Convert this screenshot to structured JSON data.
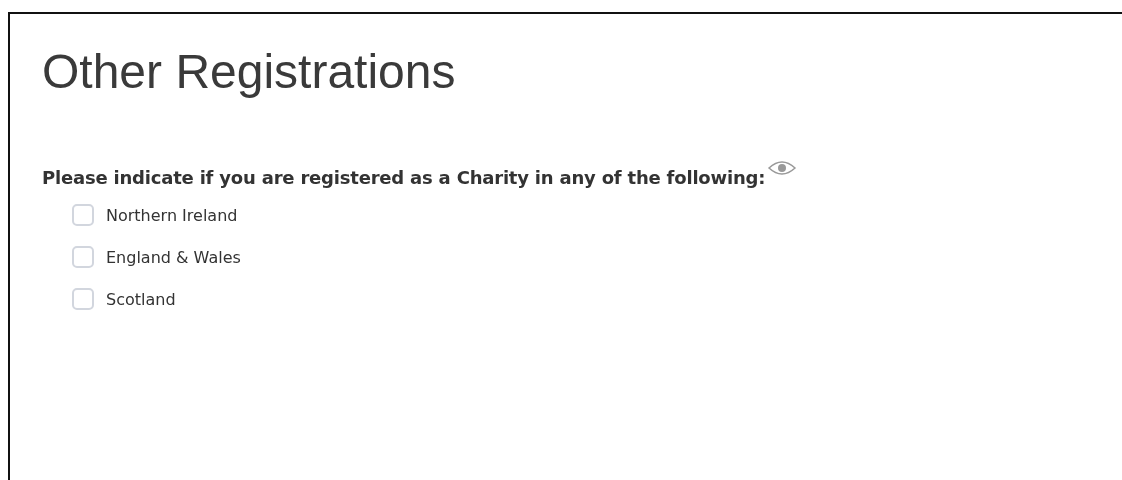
{
  "heading": "Other Registrations",
  "question": "Please indicate if you are registered as a Charity in any of the following:",
  "options": [
    {
      "label": "Northern Ireland",
      "checked": false
    },
    {
      "label": "England & Wales",
      "checked": false
    },
    {
      "label": "Scotland",
      "checked": false
    }
  ]
}
